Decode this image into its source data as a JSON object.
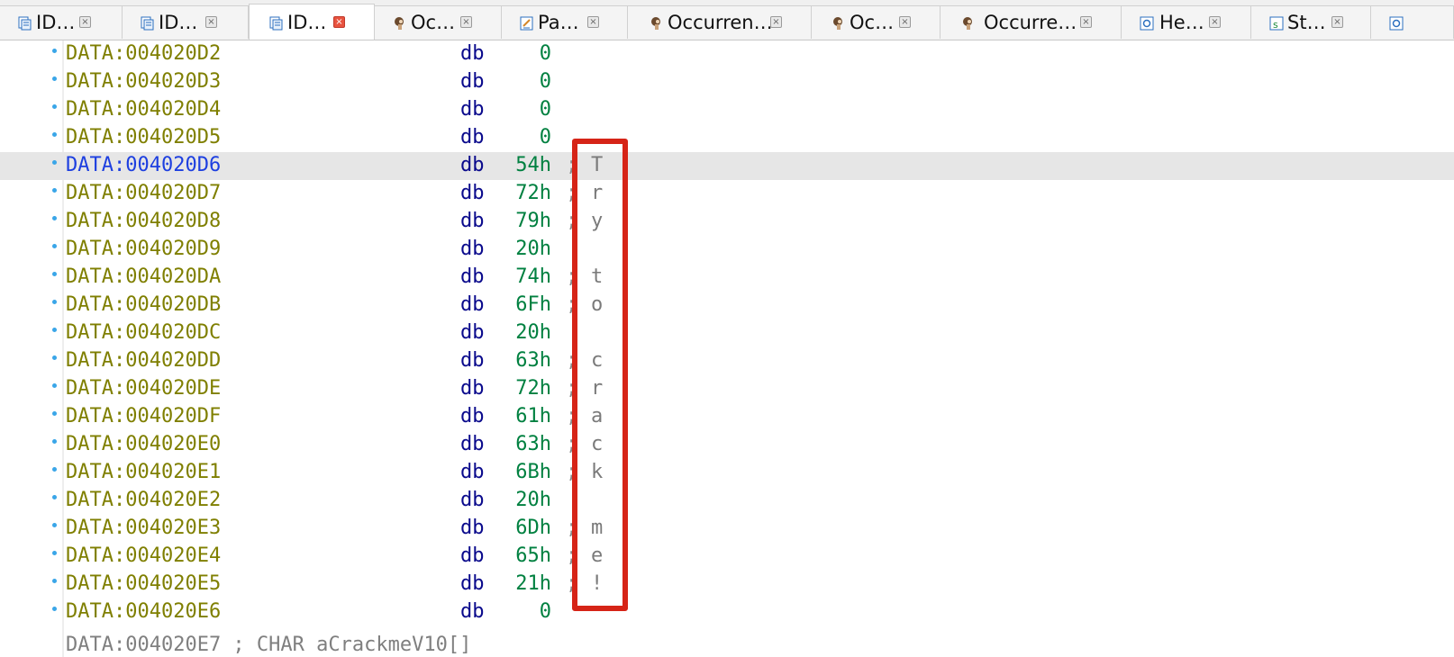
{
  "tabs": [
    {
      "label": "ID…",
      "icon": "ida-view-icon",
      "active": false
    },
    {
      "label": "ID…",
      "icon": "ida-view-icon",
      "active": false
    },
    {
      "label": "ID…",
      "icon": "ida-view-icon",
      "active": true
    },
    {
      "label": "Oc…",
      "icon": "occurrences-icon",
      "active": false
    },
    {
      "label": "Pa…",
      "icon": "pseudocode-icon",
      "active": false
    },
    {
      "label": "Occurren…",
      "icon": "occurrences-icon",
      "active": false
    },
    {
      "label": "Oc…",
      "icon": "occurrences-icon",
      "active": false
    },
    {
      "label": "Occurre…",
      "icon": "occurrences-icon",
      "active": false
    },
    {
      "label": "He…",
      "icon": "hex-view-icon",
      "active": false
    },
    {
      "label": "St…",
      "icon": "strings-icon",
      "active": false
    }
  ],
  "tab_close_glyph": "×",
  "listing": {
    "rows": [
      {
        "address": "DATA:004020D2",
        "mnemonic": "db",
        "value": "0",
        "comment": "",
        "char": ""
      },
      {
        "address": "DATA:004020D3",
        "mnemonic": "db",
        "value": "0",
        "comment": "",
        "char": ""
      },
      {
        "address": "DATA:004020D4",
        "mnemonic": "db",
        "value": "0",
        "comment": "",
        "char": ""
      },
      {
        "address": "DATA:004020D5",
        "mnemonic": "db",
        "value": "0",
        "comment": "",
        "char": ""
      },
      {
        "address": "DATA:004020D6",
        "mnemonic": "db",
        "value": "54h",
        "comment": ";",
        "char": "T",
        "selected": true
      },
      {
        "address": "DATA:004020D7",
        "mnemonic": "db",
        "value": "72h",
        "comment": ";",
        "char": "r"
      },
      {
        "address": "DATA:004020D8",
        "mnemonic": "db",
        "value": "79h",
        "comment": ";",
        "char": "y"
      },
      {
        "address": "DATA:004020D9",
        "mnemonic": "db",
        "value": "20h",
        "comment": "",
        "char": ""
      },
      {
        "address": "DATA:004020DA",
        "mnemonic": "db",
        "value": "74h",
        "comment": ";",
        "char": "t"
      },
      {
        "address": "DATA:004020DB",
        "mnemonic": "db",
        "value": "6Fh",
        "comment": ";",
        "char": "o"
      },
      {
        "address": "DATA:004020DC",
        "mnemonic": "db",
        "value": "20h",
        "comment": "",
        "char": ""
      },
      {
        "address": "DATA:004020DD",
        "mnemonic": "db",
        "value": "63h",
        "comment": ";",
        "char": "c"
      },
      {
        "address": "DATA:004020DE",
        "mnemonic": "db",
        "value": "72h",
        "comment": ";",
        "char": "r"
      },
      {
        "address": "DATA:004020DF",
        "mnemonic": "db",
        "value": "61h",
        "comment": ";",
        "char": "a"
      },
      {
        "address": "DATA:004020E0",
        "mnemonic": "db",
        "value": "63h",
        "comment": ";",
        "char": "c"
      },
      {
        "address": "DATA:004020E1",
        "mnemonic": "db",
        "value": "6Bh",
        "comment": ";",
        "char": "k"
      },
      {
        "address": "DATA:004020E2",
        "mnemonic": "db",
        "value": "20h",
        "comment": "",
        "char": ""
      },
      {
        "address": "DATA:004020E3",
        "mnemonic": "db",
        "value": "6Dh",
        "comment": ";",
        "char": "m"
      },
      {
        "address": "DATA:004020E4",
        "mnemonic": "db",
        "value": "65h",
        "comment": ";",
        "char": "e"
      },
      {
        "address": "DATA:004020E5",
        "mnemonic": "db",
        "value": "21h",
        "comment": ";",
        "char": "!"
      },
      {
        "address": "DATA:004020E6",
        "mnemonic": "db",
        "value": "0",
        "comment": "",
        "char": ""
      }
    ],
    "cut_line": "DATA:004020E7 ; CHAR aCrackmeV10[]"
  },
  "colors": {
    "address": "#7f7f00",
    "selected_address": "#1d3fe0",
    "mnemonic": "#0a0a8c",
    "value": "#008040",
    "highlight_box": "#d62417",
    "selected_row": "#e6e6e6"
  }
}
